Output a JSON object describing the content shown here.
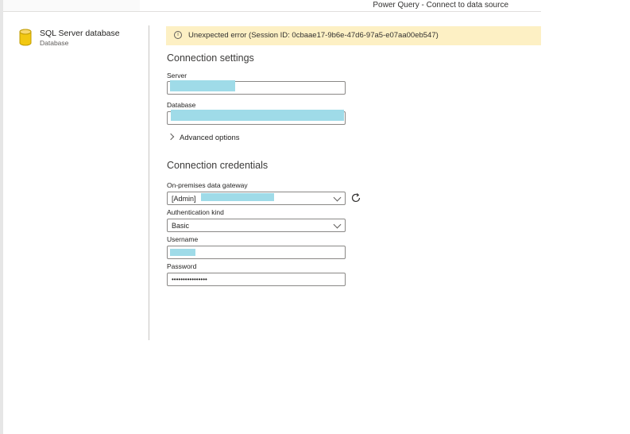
{
  "window": {
    "title": "Power Query - Connect to data source"
  },
  "sidebar": {
    "icon": "database-icon",
    "title": "SQL Server database",
    "subtitle": "Database"
  },
  "error": {
    "icon": "info-icon",
    "message": "Unexpected error (Session ID: 0cbaae17-9b6e-47d6-97a5-e07aa00eb547)"
  },
  "connection_settings": {
    "heading": "Connection settings",
    "server": {
      "label": "Server",
      "value": ""
    },
    "database": {
      "label": "Database",
      "value": ""
    },
    "advanced_options": "Advanced options"
  },
  "credentials": {
    "heading": "Connection credentials",
    "gateway": {
      "label": "On-premises data gateway",
      "value": "[Admin]"
    },
    "auth_kind": {
      "label": "Authentication kind",
      "value": "Basic"
    },
    "username": {
      "label": "Username",
      "value": ""
    },
    "password": {
      "label": "Password",
      "value": "••••••••••••••••"
    }
  },
  "colors": {
    "error_bg": "#fdf0c4",
    "redaction": "#9fdbe8",
    "icon_yellow": "#f2c811"
  }
}
